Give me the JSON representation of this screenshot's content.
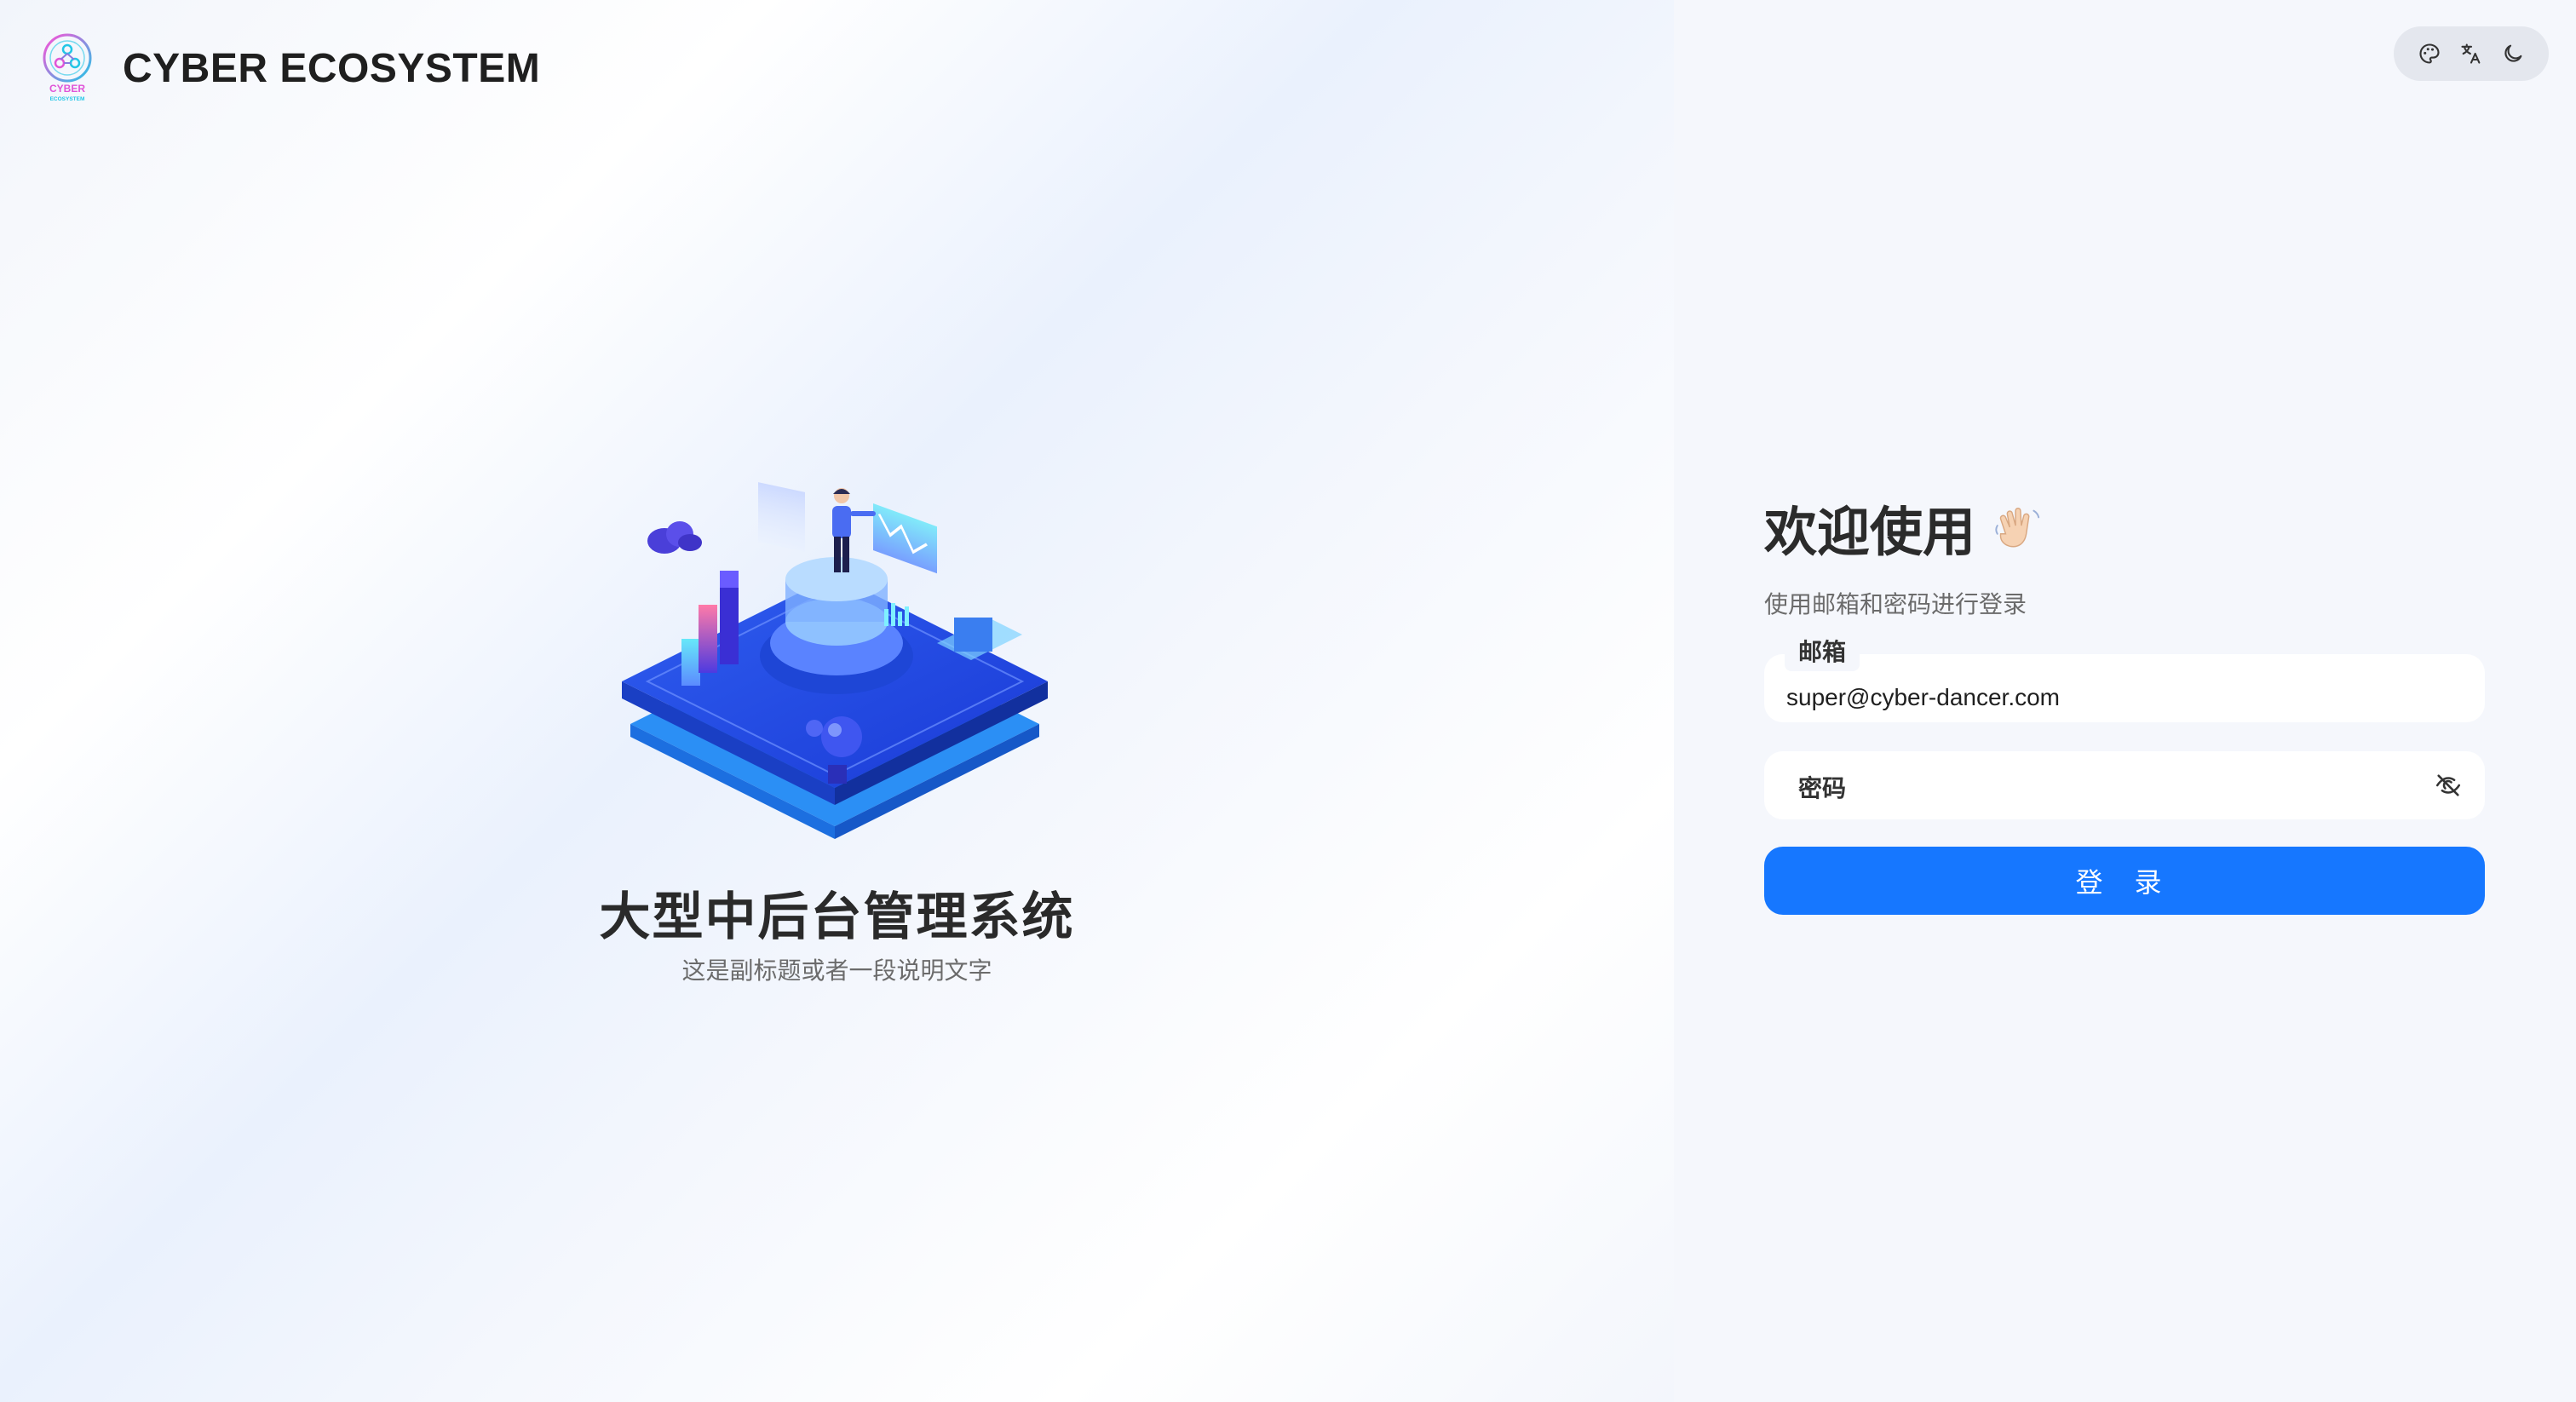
{
  "brand": {
    "logo_text_top": "CYBER",
    "logo_text_bottom": "ECOSYSTEM",
    "name": "CYBER ECOSYSTEM"
  },
  "hero": {
    "title": "大型中后台管理系统",
    "subtitle": "这是副标题或者一段说明文字"
  },
  "toolbar": {
    "icons": [
      "palette-icon",
      "translate-icon",
      "moon-icon"
    ]
  },
  "login": {
    "title": "欢迎使用",
    "title_emoji": "waving-hand-icon",
    "subtitle": "使用邮箱和密码进行登录",
    "email_label": "邮箱",
    "email_value": "super@cyber-dancer.com",
    "password_label": "密码",
    "submit_label": "登 录"
  },
  "colors": {
    "primary": "#1677ff",
    "panel_bg": "#f5f7fc",
    "toolbar_bg": "#e4e7ee"
  }
}
